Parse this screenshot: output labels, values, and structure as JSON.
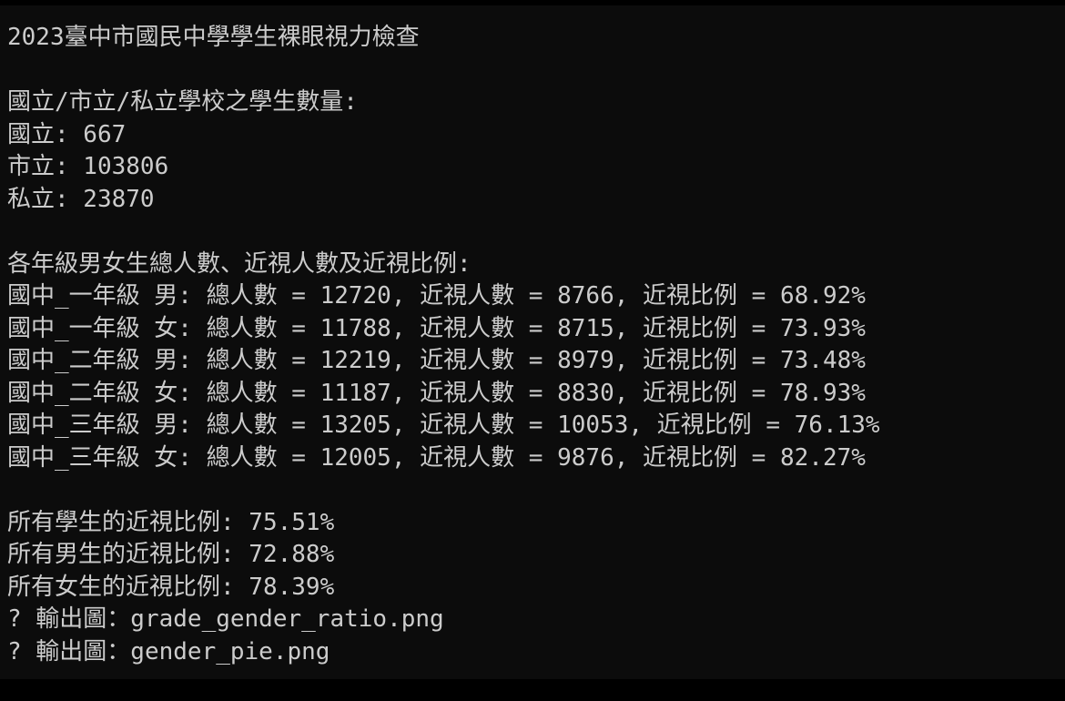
{
  "colors": {
    "background": "#0c0c0c",
    "frame": "#000000",
    "text": "#cccccc"
  },
  "terminal": {
    "title": "2023臺中市國民中學學生裸眼視力檢查",
    "school_header": "國立/市立/私立學校之學生數量:",
    "schools": [
      "國立: 667",
      "市立: 103806",
      "私立: 23870"
    ],
    "grade_header": "各年級男女生總人數、近視人數及近視比例:",
    "grades": [
      "國中_一年級 男: 總人數 = 12720, 近視人數 = 8766, 近視比例 = 68.92%",
      "國中_一年級 女: 總人數 = 11788, 近視人數 = 8715, 近視比例 = 73.93%",
      "國中_二年級 男: 總人數 = 12219, 近視人數 = 8979, 近視比例 = 73.48%",
      "國中_二年級 女: 總人數 = 11187, 近視人數 = 8830, 近視比例 = 78.93%",
      "國中_三年級 男: 總人數 = 13205, 近視人數 = 10053, 近視比例 = 76.13%",
      "國中_三年級 女: 總人數 = 12005, 近視人數 = 9876, 近視比例 = 82.27%"
    ],
    "summary": [
      "所有學生的近視比例: 75.51%",
      "所有男生的近視比例: 72.88%",
      "所有女生的近視比例: 78.39%"
    ],
    "outputs": [
      "? 輸出圖：grade_gender_ratio.png",
      "? 輸出圖：gender_pie.png"
    ]
  }
}
